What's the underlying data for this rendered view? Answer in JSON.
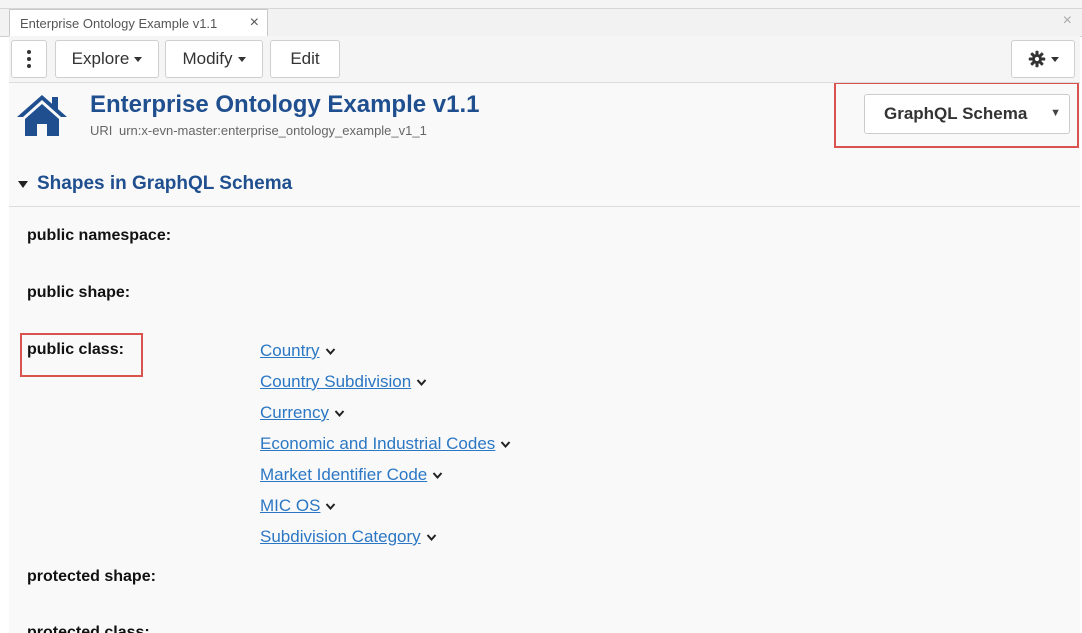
{
  "tab": {
    "title": "Enterprise Ontology Example v1.1",
    "close_glyph": "×"
  },
  "window": {
    "close_glyph": "×"
  },
  "toolbar": {
    "explore_label": "Explore",
    "modify_label": "Modify",
    "edit_label": "Edit"
  },
  "header": {
    "title": "Enterprise Ontology Example v1.1",
    "uri_label": "URI",
    "uri_value": "urn:x-evn-master:enterprise_ontology_example_v1_1"
  },
  "view_selector": {
    "selected": "GraphQL Schema",
    "arrow_glyph": "▼"
  },
  "section": {
    "title": "Shapes in GraphQL Schema"
  },
  "labels": {
    "public_namespace": "public namespace:",
    "public_shape": "public shape:",
    "public_class": "public class:",
    "protected_shape": "protected shape:",
    "protected_class": "protected class:"
  },
  "public_classes": [
    {
      "label": "Country"
    },
    {
      "label": "Country Subdivision"
    },
    {
      "label": "Currency"
    },
    {
      "label": "Economic and Industrial Codes"
    },
    {
      "label": "Market Identifier Code"
    },
    {
      "label": "MIC OS"
    },
    {
      "label": "Subdivision Category"
    }
  ],
  "colors": {
    "accent": "#1f4f8f",
    "link": "#2b77c4",
    "highlight": "#d9534f"
  },
  "icons": {
    "home": "home-icon",
    "gear": "gear-icon",
    "kebab": "kebab-menu-icon",
    "chevron": "chevron-down-icon"
  }
}
